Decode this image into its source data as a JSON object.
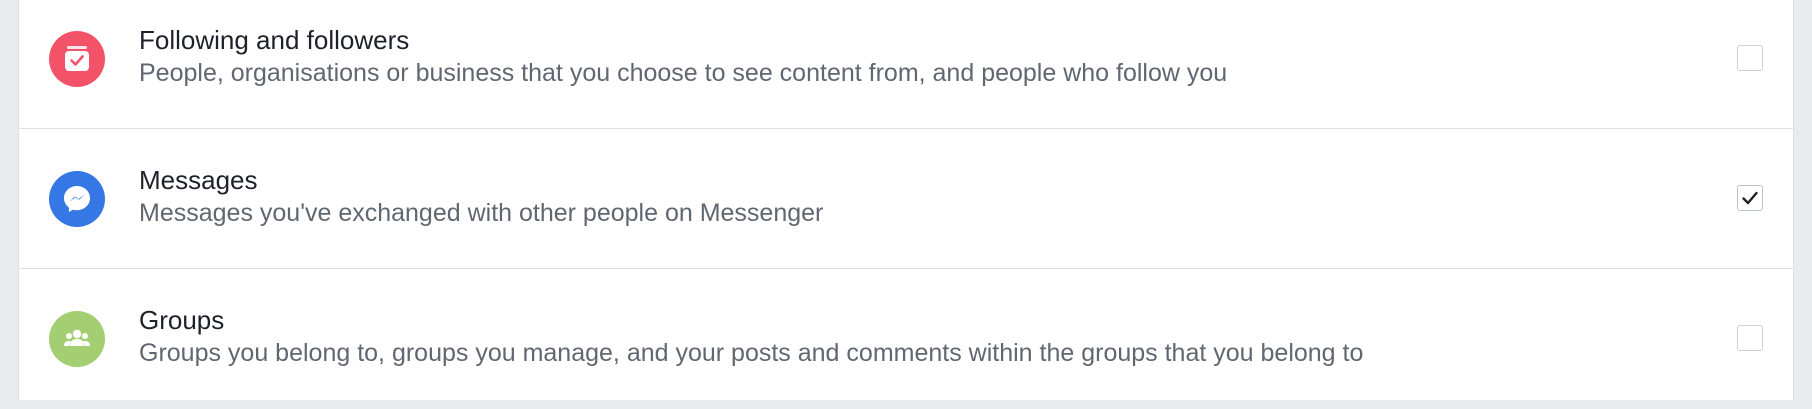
{
  "items": [
    {
      "title": "Following and followers",
      "description": "People, organisations or business that you choose to see content from, and people who follow you",
      "icon": "calendar-check-icon",
      "icon_color": "#f35369",
      "checked": false
    },
    {
      "title": "Messages",
      "description": "Messages you've exchanged with other people on Messenger",
      "icon": "messenger-icon",
      "icon_color": "#3578e5",
      "checked": true
    },
    {
      "title": "Groups",
      "description": "Groups you belong to, groups you manage, and your posts and comments within the groups that you belong to",
      "icon": "groups-icon",
      "icon_color": "#a3ce71",
      "checked": false
    }
  ]
}
